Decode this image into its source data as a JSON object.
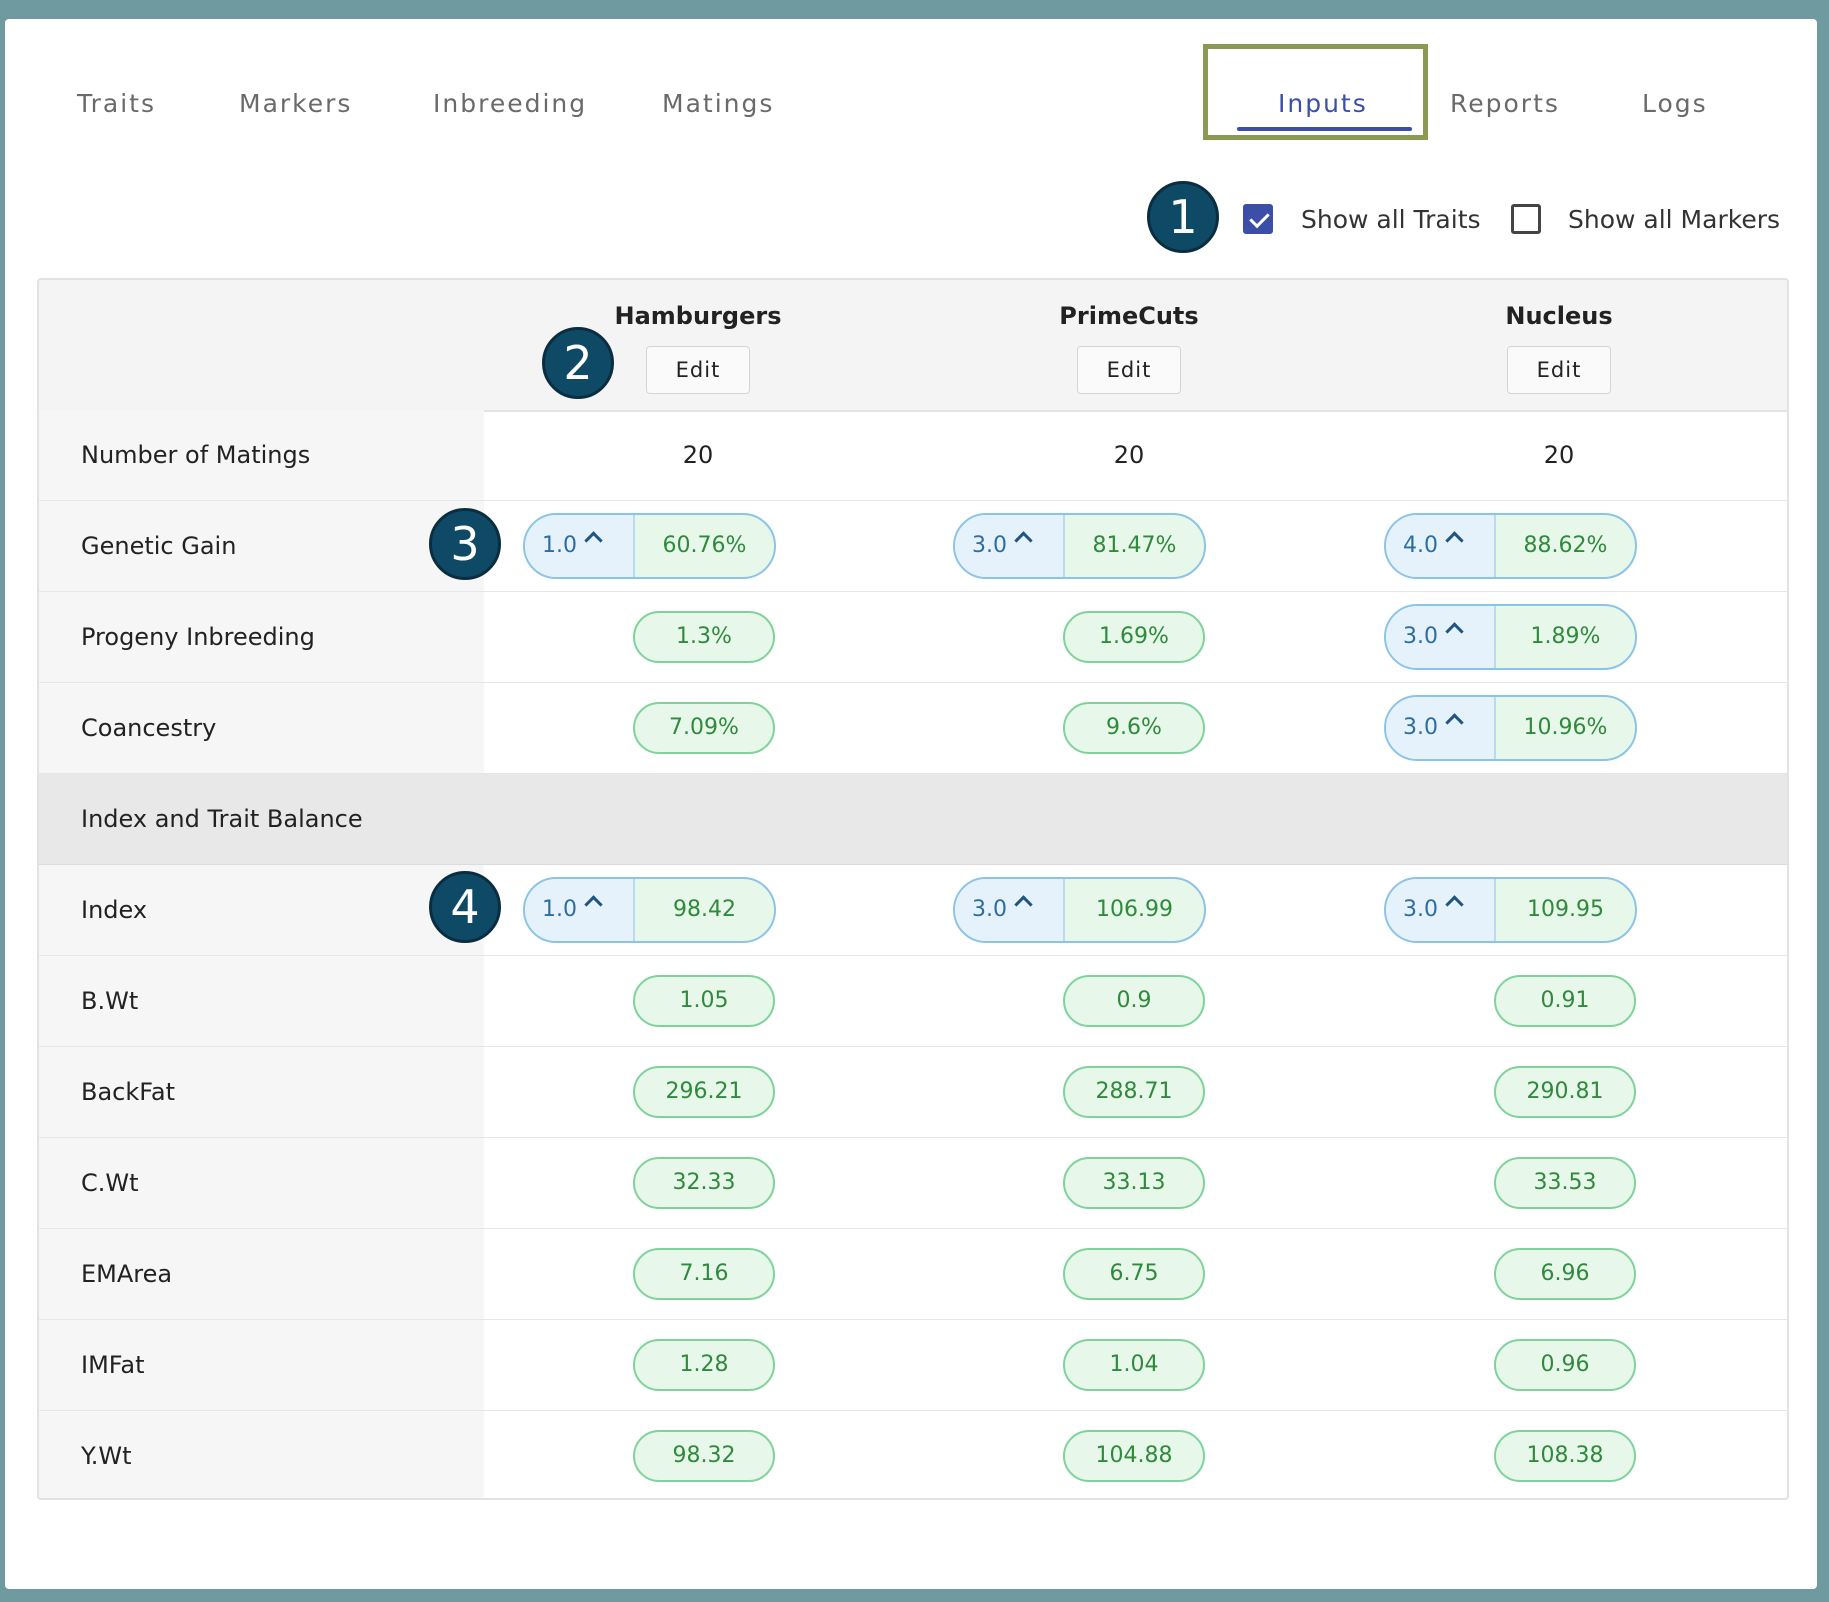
{
  "tabs": {
    "traits": "Traits",
    "markers": "Markers",
    "inbreeding": "Inbreeding",
    "matings": "Matings",
    "inputs": "Inputs",
    "reports": "Reports",
    "logs": "Logs",
    "active": "Inputs"
  },
  "badges": [
    "1",
    "2",
    "3",
    "4"
  ],
  "options": {
    "show_all_traits": {
      "label": "Show all Traits",
      "checked": true
    },
    "show_all_markers": {
      "label": "Show all Markers",
      "checked": false
    }
  },
  "columns": [
    {
      "title": "Hamburgers",
      "edit": "Edit"
    },
    {
      "title": "PrimeCuts",
      "edit": "Edit"
    },
    {
      "title": "Nucleus",
      "edit": "Edit"
    }
  ],
  "rows": {
    "matings": {
      "label": "Number of Matings",
      "values": [
        "20",
        "20",
        "20"
      ]
    },
    "genetic_gain": {
      "label": "Genetic Gain",
      "weights": [
        "1.0",
        "3.0",
        "4.0"
      ],
      "values": [
        "60.76%",
        "81.47%",
        "88.62%"
      ]
    },
    "progeny_inbreeding": {
      "label": "Progeny Inbreeding",
      "values": [
        "1.3%",
        "1.69%",
        "1.89%"
      ],
      "nucleus_weight": "3.0"
    },
    "coancestry": {
      "label": "Coancestry",
      "values": [
        "7.09%",
        "9.6%",
        "10.96%"
      ],
      "nucleus_weight": "3.0"
    },
    "section": "Index and Trait Balance",
    "index": {
      "label": "Index",
      "weights": [
        "1.0",
        "3.0",
        "3.0"
      ],
      "values": [
        "98.42",
        "106.99",
        "109.95"
      ]
    },
    "traits": [
      {
        "label": "B.Wt",
        "values": [
          "1.05",
          "0.9",
          "0.91"
        ]
      },
      {
        "label": "BackFat",
        "values": [
          "296.21",
          "288.71",
          "290.81"
        ]
      },
      {
        "label": "C.Wt",
        "values": [
          "32.33",
          "33.13",
          "33.53"
        ]
      },
      {
        "label": "EMArea",
        "values": [
          "7.16",
          "6.75",
          "6.96"
        ]
      },
      {
        "label": "IMFat",
        "values": [
          "1.28",
          "1.04",
          "0.96"
        ]
      },
      {
        "label": "Y.Wt",
        "values": [
          "98.32",
          "104.88",
          "108.38"
        ]
      }
    ]
  }
}
